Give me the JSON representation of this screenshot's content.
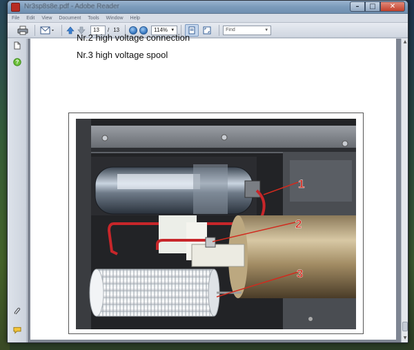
{
  "window": {
    "title": "Nr3sp8s8e.pdf - Adobe Reader",
    "controls": {
      "minimize": "–",
      "maximize": "□",
      "close": "✕"
    }
  },
  "menu": [
    "File",
    "Edit",
    "View",
    "Document",
    "Tools",
    "Window",
    "Help"
  ],
  "toolbar": {
    "page_current": "13",
    "page_separator": "/",
    "page_total": "13",
    "zoom": "114%",
    "find_placeholder": "Find"
  },
  "document": {
    "previous_heading": "Nr.2 high voltage connection",
    "heading": "Nr.3 high voltage spool",
    "callouts": [
      "1",
      "2",
      "3"
    ]
  },
  "colors": {
    "accent_red": "#d12a1e",
    "titlebar": "#7b9bbb"
  }
}
